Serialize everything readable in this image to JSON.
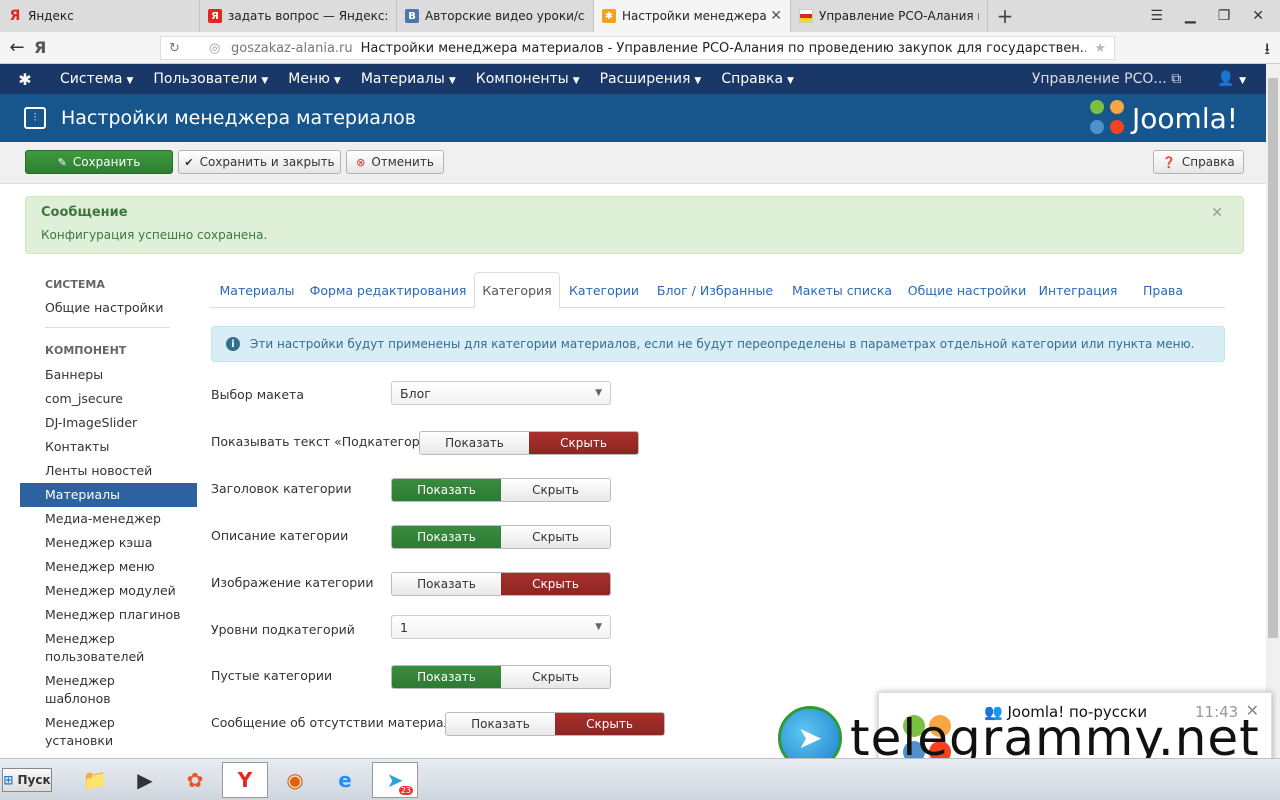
{
  "browser": {
    "tabs": [
      {
        "title": "Яндекс",
        "favicon": "yandex-icon"
      },
      {
        "title": "задать вопрос — Яндекс: на",
        "favicon": "yandex-icon"
      },
      {
        "title": "Авторские видео уроки/ста",
        "favicon": "vk-icon"
      },
      {
        "title": "Настройки менеджера ма",
        "favicon": "joomla-icon"
      },
      {
        "title": "Управление РСО-Алания по",
        "favicon": "ossetia-flag-icon"
      }
    ],
    "address": {
      "domain": "goszakaz-alania.ru",
      "page_title": "Настройки менеджера материалов - Управление РСО-Алания по проведению закупок для государствен..."
    }
  },
  "topnav": {
    "items": [
      "Система",
      "Пользователи",
      "Меню",
      "Материалы",
      "Компоненты",
      "Расширения",
      "Справка"
    ],
    "site_link": "Управление РСО...",
    "colors": {
      "navbar": "#1a3867",
      "header": "#17568c"
    }
  },
  "header": {
    "title": "Настройки менеджера материалов",
    "brand": "Joomla!"
  },
  "toolbar": {
    "save": "Сохранить",
    "save_close": "Сохранить и закрыть",
    "cancel": "Отменить",
    "help": "Справка"
  },
  "alert": {
    "title": "Сообщение",
    "text": "Конфигурация успешно сохранена."
  },
  "sidebar": {
    "system_heading": "Система",
    "system_items": [
      "Общие настройки"
    ],
    "component_heading": "Компонент",
    "component_items": [
      "Баннеры",
      "com_jsecure",
      "DJ-ImageSlider",
      "Контакты",
      "Ленты новостей",
      "Материалы",
      "Медиа-менеджер",
      "Менеджер кэша",
      "Менеджер меню",
      "Менеджер модулей",
      "Менеджер плагинов",
      "Менеджер пользователей",
      "Менеджер шаблонов",
      "Менеджер установки"
    ],
    "active": "Материалы"
  },
  "tabs": [
    "Материалы",
    "Форма редактирования",
    "Категория",
    "Категории",
    "Блог / Избранные",
    "Макеты списка",
    "Общие настройки",
    "Интеграция",
    "Права"
  ],
  "active_tab": "Категория",
  "info": "Эти настройки будут применены для категории материалов, если не будут переопределены в параметрах отдельной категории или пункта меню.",
  "form": {
    "layout_label": "Выбор макета",
    "layout_value": "Блог",
    "subcat_text_label": "Показывать текст «Подкатегории»",
    "cat_title_label": "Заголовок категории",
    "cat_desc_label": "Описание категории",
    "cat_image_label": "Изображение категории",
    "subcat_levels_label": "Уровни подкатегорий",
    "subcat_levels_value": "1",
    "empty_cats_label": "Пустые категории",
    "no_articles_label": "Сообщение об отсутствии материалов",
    "show": "Показать",
    "hide": "Скрыть"
  },
  "notification": {
    "title": "Joomla! по-русски",
    "time": "11:43"
  },
  "watermark": "telegrammy.net",
  "taskbar": {
    "start": "Пуск",
    "badge": "23"
  }
}
